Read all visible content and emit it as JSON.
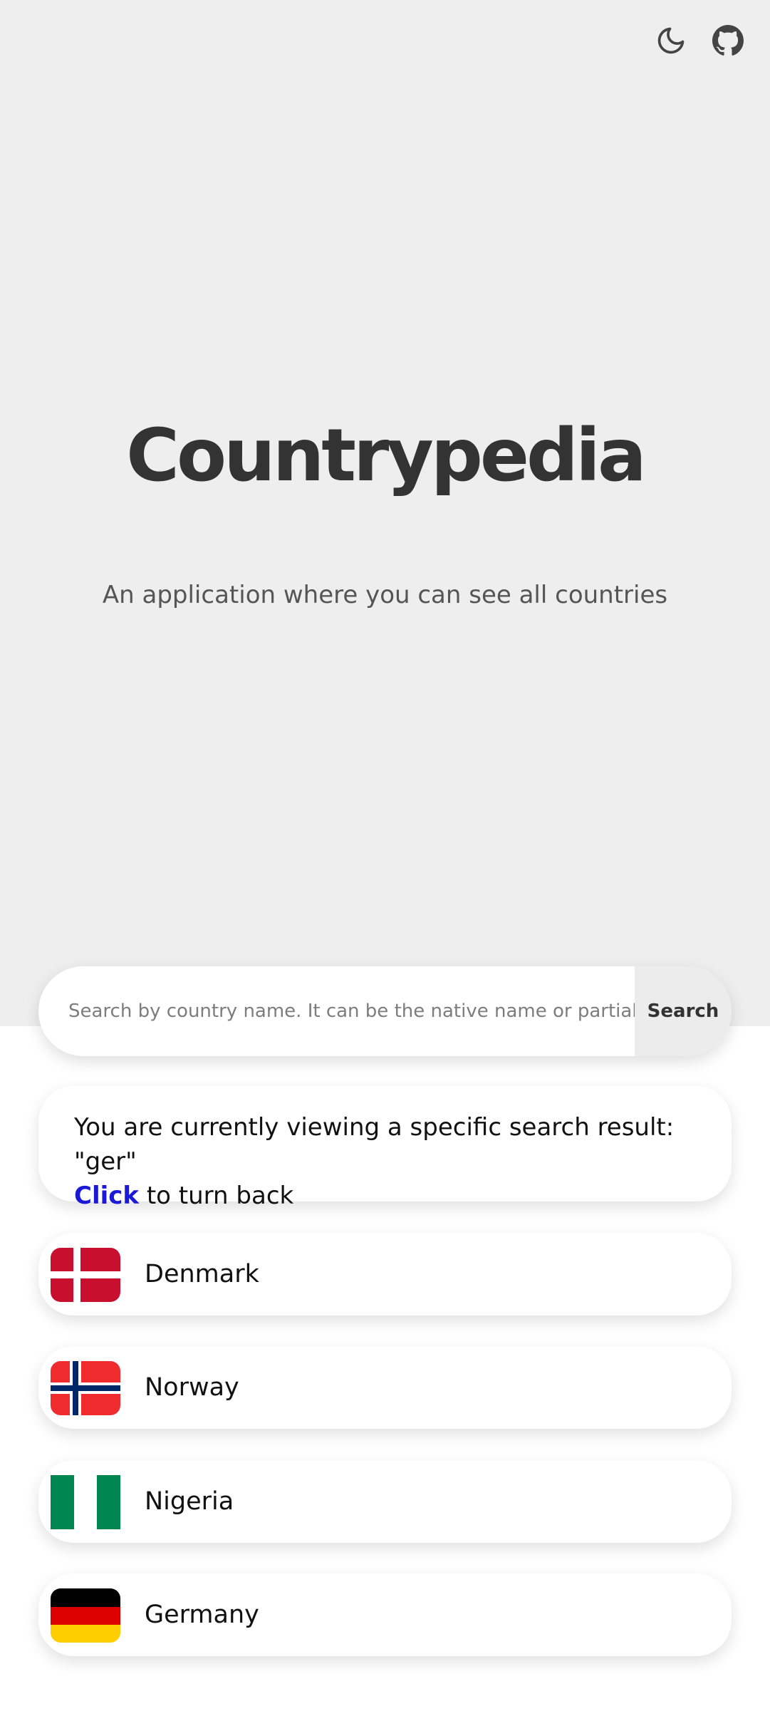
{
  "app": {
    "title": "Countrypedia",
    "subtitle": "An application where you can see all countries"
  },
  "header": {
    "icons": [
      "moon-icon",
      "github-icon"
    ]
  },
  "search": {
    "placeholder": "Search by country name. It can be the native name or partial name",
    "value": "",
    "button_label": "Search"
  },
  "notice": {
    "text": "You are currently viewing a specific search result: \"ger\"",
    "link_label": "Click",
    "link_suffix": " to turn back"
  },
  "countries": [
    {
      "name": "Denmark",
      "flag": "denmark-flag"
    },
    {
      "name": "Norway",
      "flag": "norway-flag"
    },
    {
      "name": "Nigeria",
      "flag": "nigeria-flag"
    },
    {
      "name": "Germany",
      "flag": "germany-flag"
    }
  ],
  "colors": {
    "hero_bg": "#eeeeee",
    "link": "#1a1ad6",
    "text": "#333333"
  }
}
